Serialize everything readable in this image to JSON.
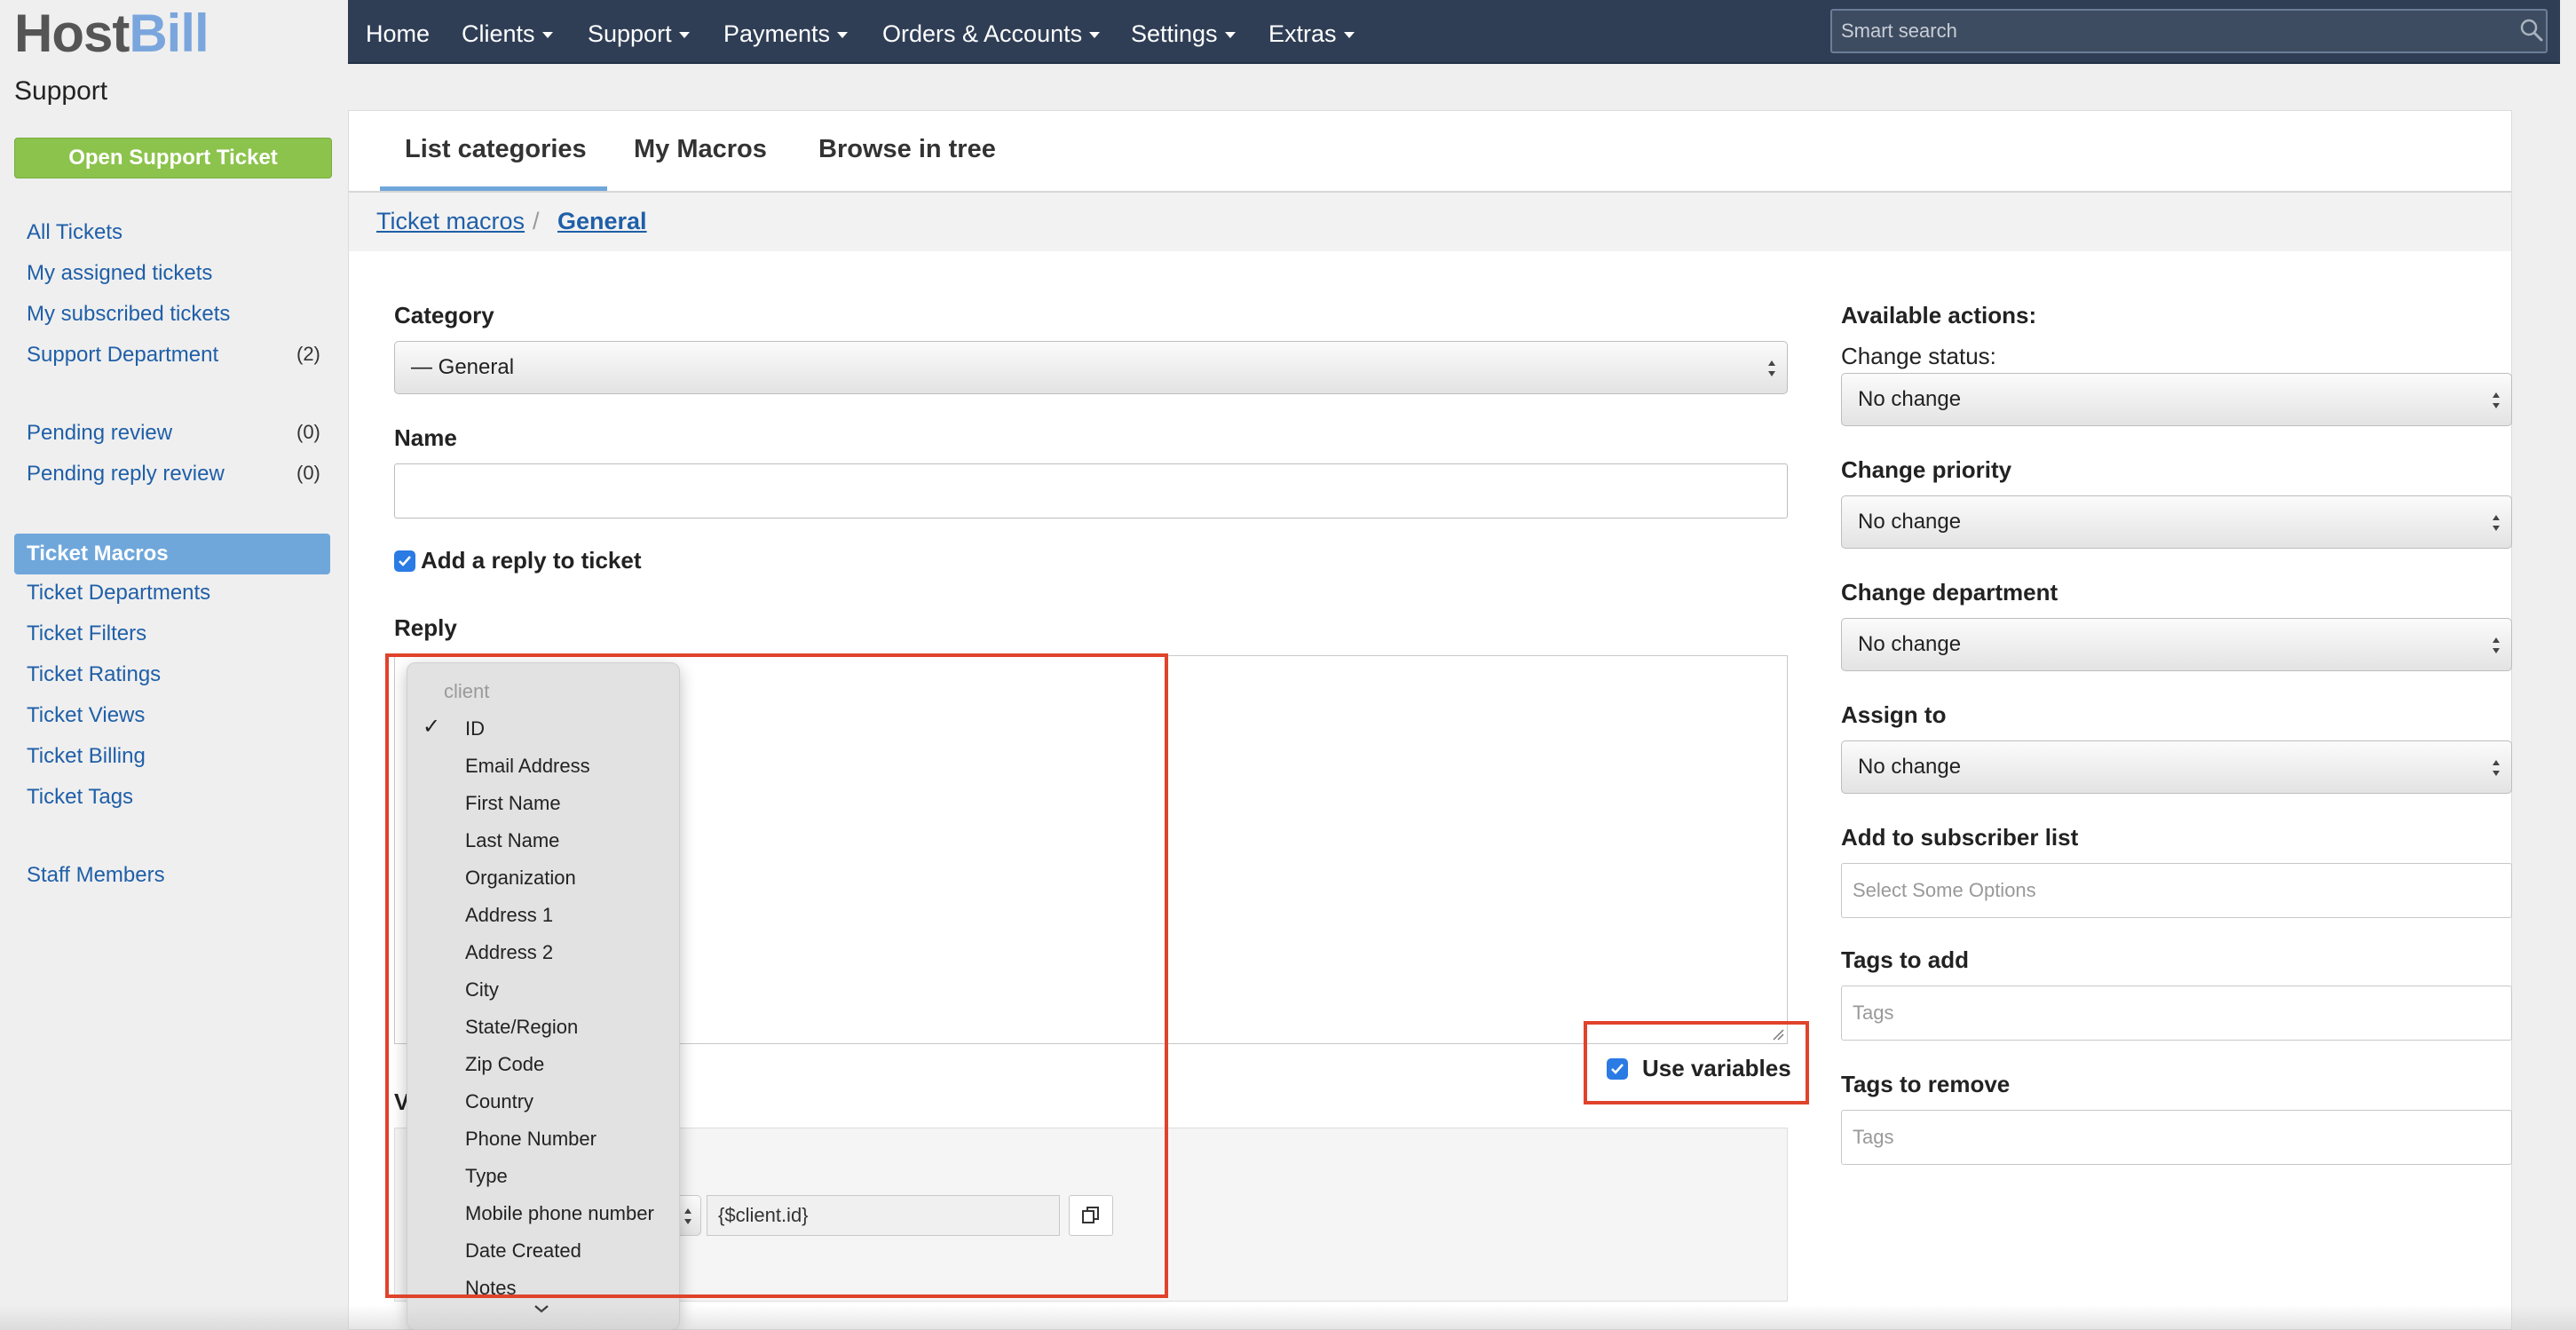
{
  "brand": {
    "part1": "Host",
    "part2": "Bill"
  },
  "sidebar": {
    "title": "Support",
    "open_ticket_button": "Open Support Ticket",
    "items": [
      {
        "label": "All Tickets"
      },
      {
        "label": "My assigned tickets"
      },
      {
        "label": "My subscribed tickets"
      },
      {
        "label": "Support Department",
        "count": "(2)"
      },
      {
        "label": "Pending review",
        "count": "(0)"
      },
      {
        "label": "Pending reply review",
        "count": "(0)"
      },
      {
        "label": "Ticket Macros",
        "active": true
      },
      {
        "label": "Ticket Departments"
      },
      {
        "label": "Ticket Filters"
      },
      {
        "label": "Ticket Ratings"
      },
      {
        "label": "Ticket Views"
      },
      {
        "label": "Ticket Billing"
      },
      {
        "label": "Ticket Tags"
      },
      {
        "label": "Staff Members"
      }
    ]
  },
  "topnav": {
    "items": [
      {
        "label": "Home",
        "has_caret": false
      },
      {
        "label": "Clients",
        "has_caret": true
      },
      {
        "label": "Support",
        "has_caret": true
      },
      {
        "label": "Payments",
        "has_caret": true
      },
      {
        "label": "Orders & Accounts",
        "has_caret": true
      },
      {
        "label": "Settings",
        "has_caret": true
      },
      {
        "label": "Extras",
        "has_caret": true
      }
    ],
    "search_placeholder": "Smart search"
  },
  "tabs": [
    {
      "label": "List categories",
      "active": true
    },
    {
      "label": "My Macros"
    },
    {
      "label": "Browse in tree"
    }
  ],
  "breadcrumb": [
    {
      "label": "Ticket macros"
    },
    {
      "label": "General",
      "current": true
    }
  ],
  "breadcrumb_separator": "/",
  "form": {
    "category_label": "Category",
    "category_value": "— General",
    "name_label": "Name",
    "name_value": "",
    "add_reply_label": "Add a reply to ticket",
    "add_reply_checked": true,
    "reply_label": "Reply",
    "use_variables_label": "Use variables",
    "use_variables_checked": true,
    "variables_label_partial": "V",
    "variable_value": "{$client.id}"
  },
  "variable_dropdown": {
    "group": "client",
    "selected": "ID",
    "items": [
      "ID",
      "Email Address",
      "First Name",
      "Last Name",
      "Organization",
      "Address 1",
      "Address 2",
      "City",
      "State/Region",
      "Zip Code",
      "Country",
      "Phone Number",
      "Type",
      "Mobile phone number",
      "Date Created",
      "Notes"
    ]
  },
  "actions": {
    "title": "Available actions:",
    "change_status_label": "Change status:",
    "change_status_value": "No change",
    "change_priority_label": "Change priority",
    "change_priority_value": "No change",
    "change_department_label": "Change department",
    "change_department_value": "No change",
    "assign_to_label": "Assign to",
    "assign_to_value": "No change",
    "subscriber_label": "Add to subscriber list",
    "subscriber_placeholder": "Select Some Options",
    "tags_add_label": "Tags to add",
    "tags_add_placeholder": "Tags",
    "tags_remove_label": "Tags to remove",
    "tags_remove_placeholder": "Tags"
  },
  "colors": {
    "nav_bg": "#2f3e55",
    "accent_blue": "#6fa7db",
    "green_button": "#8cc34c",
    "highlight_red": "#e0432b",
    "link": "#1f5fa8"
  }
}
